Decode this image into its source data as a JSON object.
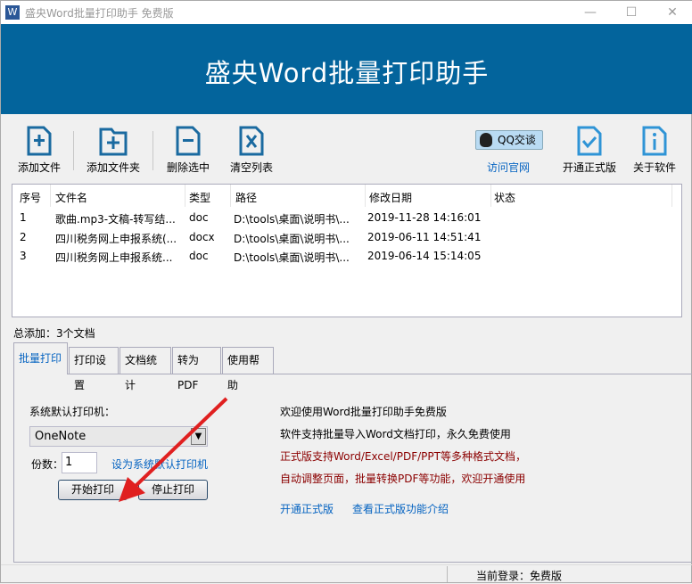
{
  "window": {
    "title": "盛央Word批量打印助手 免费版",
    "icon": "W",
    "minimize": "—",
    "maximize": "☐",
    "close": "✕"
  },
  "banner": {
    "title": "盛央Word批量打印助手"
  },
  "toolbar": {
    "add_file": "添加文件",
    "add_folder": "添加文件夹",
    "delete_selected": "删除选中",
    "clear_list": "清空列表",
    "qq": "QQ交谈",
    "visit_site": "访问官网",
    "upgrade": "开通正式版",
    "about": "关于软件"
  },
  "list": {
    "headers": [
      "序号",
      "文件名",
      "类型",
      "路径",
      "修改日期",
      "状态"
    ],
    "rows": [
      [
        "1",
        "歌曲.mp3-文稿-转写结...",
        "doc",
        "D:\\tools\\桌面\\说明书\\...",
        "2019-11-28 14:16:01",
        ""
      ],
      [
        "2",
        "四川税务网上申报系统(...",
        "docx",
        "D:\\tools\\桌面\\说明书\\...",
        "2019-06-11 14:51:41",
        ""
      ],
      [
        "3",
        "四川税务网上申报系统...",
        "doc",
        "D:\\tools\\桌面\\说明书\\...",
        "2019-06-14 15:14:05",
        ""
      ]
    ]
  },
  "total": "总添加：3个文档",
  "tabs": [
    "批量打印",
    "打印设置",
    "文档统计",
    "转为PDF",
    "使用帮助"
  ],
  "panel": {
    "printer_label": "系统默认打印机：",
    "printer_value": "OneNote",
    "copies_label": "份数：",
    "copies_value": "1",
    "set_default": "设为系统默认打印机",
    "start": "开始打印",
    "stop": "停止打印",
    "messages": [
      "欢迎使用Word批量打印助手免费版",
      "软件支持批量导入Word文档打印，永久免费使用",
      "正式版支持Word/Excel/PDF/PPT等多种格式文档，",
      "自动调整页面，批量转换PDF等功能，欢迎开通使用"
    ],
    "link_upgrade": "开通正式版",
    "link_features": "查看正式版功能介绍"
  },
  "status": {
    "login": "当前登录：免费版"
  },
  "colors": {
    "banner": "#03649c",
    "link": "#0563c1",
    "red": "#8b0000",
    "icon": "#1a6aa0"
  }
}
